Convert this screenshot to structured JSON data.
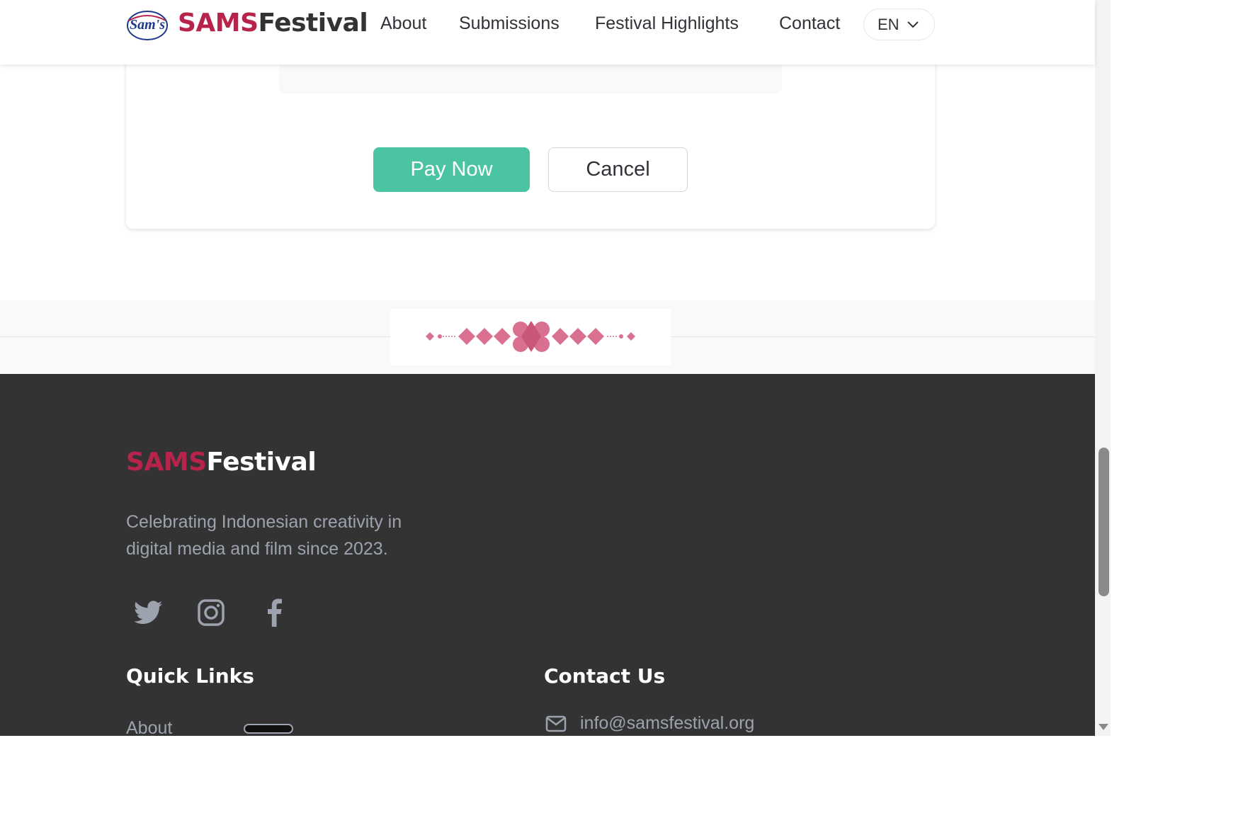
{
  "header": {
    "brand_part1": "SAMS",
    "brand_part2": "Festival",
    "nav": [
      "About",
      "Submissions",
      "Festival Highlights",
      "Contact"
    ],
    "language": "EN",
    "logo_text": "Sam's"
  },
  "payment": {
    "pay_label": "Pay Now",
    "cancel_label": "Cancel"
  },
  "footer": {
    "brand_part1": "SAMS",
    "brand_part2": "Festival",
    "tagline": "Celebrating Indonesian creativity in digital media and film since 2023.",
    "social_icons": [
      "twitter-icon",
      "instagram-icon",
      "facebook-icon"
    ],
    "quick_links_heading": "Quick Links",
    "quick_links": [
      "About"
    ],
    "contact_heading": "Contact Us",
    "email": "info@samsfestival.org"
  },
  "colors": {
    "brand_red": "#b8234b",
    "accent_green": "#4ac4a3",
    "footer_bg": "#333333",
    "ornament_pink": "#d9708f"
  }
}
